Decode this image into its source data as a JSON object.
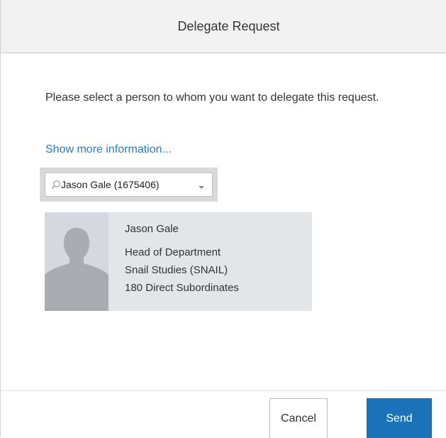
{
  "dialog": {
    "title": "Delegate Request",
    "instruction": "Please select a person to whom you want to delegate this request.",
    "more_link": "Show more information..."
  },
  "search": {
    "value": "Jason Gale (1675406)",
    "placeholder": ""
  },
  "person": {
    "name": "Jason Gale",
    "position": "Head of Department",
    "org_unit": "Snail Studies (SNAIL)",
    "subordinates": "180 Direct Subordinates"
  },
  "footer": {
    "cancel_label": "Cancel",
    "send_label": "Send"
  },
  "colors": {
    "accent": "#1a73b8",
    "link": "#2b7bbd",
    "header_bg": "#f2f2f2",
    "card_bg": "#e3e6e9"
  },
  "icons": {
    "search": "search-icon",
    "dropdown": "chevron-down-icon",
    "avatar": "person-silhouette-icon"
  }
}
